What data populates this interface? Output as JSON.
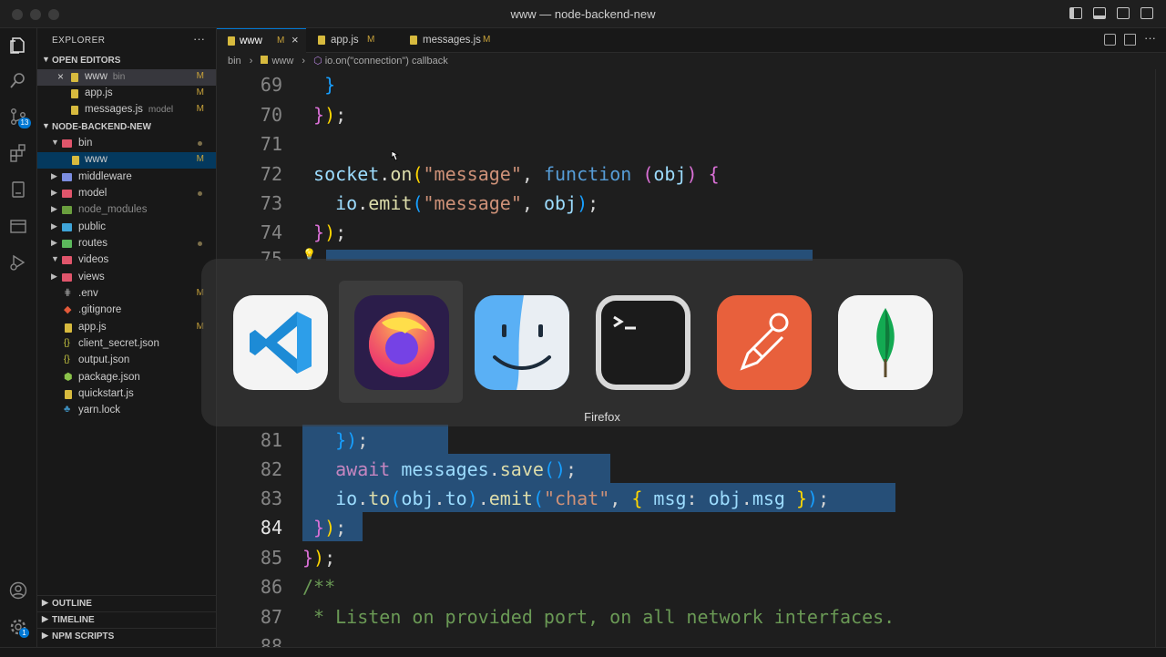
{
  "window": {
    "title": "www — node-backend-new"
  },
  "sidebar": {
    "header": "EXPLORER",
    "open_editors_title": "OPEN EDITORS",
    "open_editors": [
      {
        "name": "www",
        "desc": "bin",
        "badge": "M"
      },
      {
        "name": "app.js",
        "desc": "",
        "badge": "M"
      },
      {
        "name": "messages.js",
        "desc": "model",
        "badge": "M"
      }
    ],
    "project_title": "NODE-BACKEND-NEW",
    "tree": [
      {
        "name": "bin",
        "kind": "folder",
        "open": true,
        "deco": "dot"
      },
      {
        "name": "www",
        "kind": "file",
        "badge": "M"
      },
      {
        "name": "middleware",
        "kind": "folder"
      },
      {
        "name": "model",
        "kind": "folder",
        "deco": "dot"
      },
      {
        "name": "node_modules",
        "kind": "folder"
      },
      {
        "name": "public",
        "kind": "folder"
      },
      {
        "name": "routes",
        "kind": "folder",
        "deco": "dot"
      },
      {
        "name": "videos",
        "kind": "folder",
        "open": true
      },
      {
        "name": "views",
        "kind": "folder"
      },
      {
        "name": ".env",
        "kind": "file",
        "badge": "M"
      },
      {
        "name": ".gitignore",
        "kind": "file"
      },
      {
        "name": "app.js",
        "kind": "file",
        "badge": "M"
      },
      {
        "name": "client_secret.json",
        "kind": "file"
      },
      {
        "name": "output.json",
        "kind": "file"
      },
      {
        "name": "package.json",
        "kind": "file"
      },
      {
        "name": "quickstart.js",
        "kind": "file"
      },
      {
        "name": "yarn.lock",
        "kind": "file"
      }
    ],
    "outline": "OUTLINE",
    "timeline": "TIMELINE",
    "npm_scripts": "NPM SCRIPTS"
  },
  "activity": {
    "scm_badge": "13",
    "settings_badge": "1"
  },
  "tabs": [
    {
      "label": "www",
      "badge": "M",
      "active": true
    },
    {
      "label": "app.js",
      "badge": "M"
    },
    {
      "label": "messages.js",
      "badge": "M"
    }
  ],
  "breadcrumb": [
    "bin",
    "www",
    "io.on(\"connection\") callback"
  ],
  "editor": {
    "line_numbers": [
      "69",
      "70",
      "71",
      "72",
      "73",
      "74",
      "75",
      "81",
      "82",
      "83",
      "84",
      "85",
      "86",
      "87",
      "88"
    ],
    "current_line": "84"
  },
  "app_switcher": {
    "apps": [
      "vscode-icon",
      "firefox-icon",
      "finder-icon",
      "terminal-icon",
      "postman-icon",
      "mongodb-compass-icon"
    ],
    "selected_label": "Firefox"
  }
}
